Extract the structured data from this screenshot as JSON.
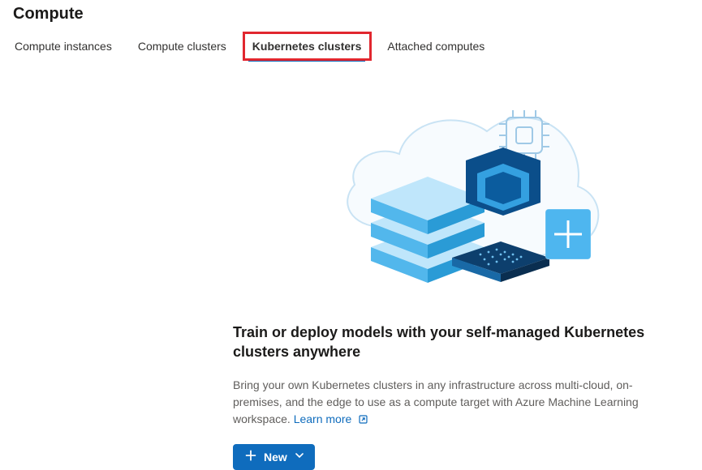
{
  "page": {
    "title": "Compute"
  },
  "tabs": {
    "items": [
      {
        "label": "Compute instances"
      },
      {
        "label": "Compute clusters"
      },
      {
        "label": "Kubernetes clusters"
      },
      {
        "label": "Attached computes"
      }
    ],
    "active_index": 2,
    "highlight_index": 2
  },
  "content": {
    "heading": "Train or deploy models with your self-managed Kubernetes clusters anywhere",
    "description": "Bring your own Kubernetes clusters in any infrastructure across multi-cloud, on-premises, and the edge to use as a compute target with Azure Machine Learning workspace. ",
    "learn_more_label": "Learn more",
    "new_button_label": "New"
  },
  "colors": {
    "primary": "#0f6cbd",
    "highlight_border": "#e1272f"
  }
}
